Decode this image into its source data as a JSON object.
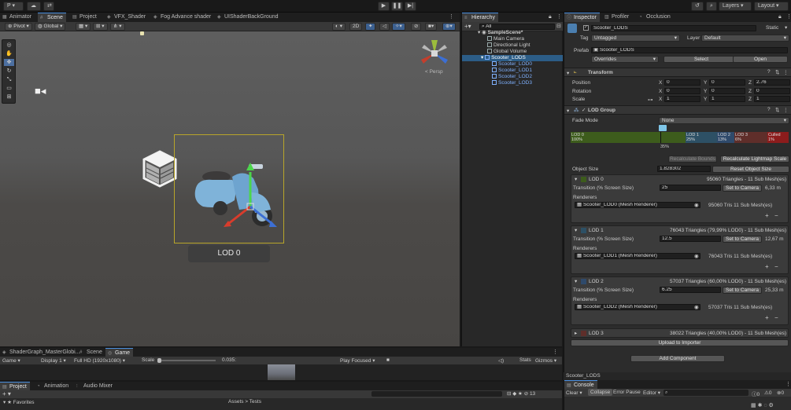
{
  "topbar": {
    "account": "P",
    "layers_label": "Layers",
    "layout_label": "Layout"
  },
  "scene_tabs": [
    {
      "label": "Animator",
      "icon": "animator-icon"
    },
    {
      "label": "Scene",
      "icon": "scene-icon"
    },
    {
      "label": "Project",
      "icon": "folder-icon"
    },
    {
      "label": "VFX_Shader",
      "icon": "shader-icon"
    },
    {
      "label": "Fog Advance shader",
      "icon": "shader-icon"
    },
    {
      "label": "UIShaderBackGround",
      "icon": "shader-icon"
    }
  ],
  "scene_toolbar": {
    "pivot": "Pivot",
    "global": "Global",
    "mode_2d": "2D",
    "persp": "< Persp"
  },
  "viewport": {
    "lod_label": "LOD 0"
  },
  "hierarchy": {
    "tab": "Hierarchy",
    "search_placeholder": "All",
    "items": [
      {
        "label": "SampleScene*",
        "indent": 0,
        "kind": "scene"
      },
      {
        "label": "Main Camera",
        "indent": 1,
        "kind": "obj"
      },
      {
        "label": "Directional Light",
        "indent": 1,
        "kind": "obj"
      },
      {
        "label": "Global Volume",
        "indent": 1,
        "kind": "obj"
      },
      {
        "label": "Scooter_LODS",
        "indent": 1,
        "kind": "selected"
      },
      {
        "label": "Scooter_LOD0",
        "indent": 2,
        "kind": "blue"
      },
      {
        "label": "Scooter_LOD1",
        "indent": 2,
        "kind": "blue"
      },
      {
        "label": "Scooter_LOD2",
        "indent": 2,
        "kind": "blue"
      },
      {
        "label": "Scooter_LOD3",
        "indent": 2,
        "kind": "blue"
      }
    ]
  },
  "game_tabs": [
    {
      "label": "ShaderGraph_MasterGlobi..."
    },
    {
      "label": "Scene"
    },
    {
      "label": "Game"
    }
  ],
  "game_toolbar": {
    "game": "Game",
    "display": "Display 1",
    "resolution": "Full HD (1920x1080)",
    "scale_label": "Scale",
    "scale_value": "0.035:",
    "play_focused": "Play Focused",
    "stats": "Stats",
    "gizmos": "Gizmos"
  },
  "project_tabs": [
    {
      "label": "Project"
    },
    {
      "label": "Animation"
    },
    {
      "label": "Audio Mixer"
    }
  ],
  "project_body": {
    "favorites": "Favorites",
    "breadcrumb": "Assets > Tests"
  },
  "inspector": {
    "tabs": [
      "Inspector",
      "Profiler",
      "Occlusion"
    ],
    "object_name": "Scooter_LODS",
    "static_label": "Static",
    "tag_label": "Tag",
    "tag_value": "Untagged",
    "layer_label": "Layer",
    "layer_value": "Default",
    "prefab_label": "Prefab",
    "prefab_value": "Scooter_LODS",
    "overrides": "Overrides",
    "select": "Select",
    "open": "Open",
    "transform": {
      "title": "Transform",
      "position_label": "Position",
      "rotation_label": "Rotation",
      "scale_label": "Scale",
      "position": [
        "0",
        "0",
        "2.76"
      ],
      "rotation": [
        "0",
        "0",
        "0"
      ],
      "scale": [
        "1",
        "1",
        "1"
      ],
      "axes": [
        "X",
        "Y",
        "Z"
      ]
    },
    "lod_group": {
      "title": "LOD Group",
      "fade_mode_label": "Fade Mode",
      "fade_mode_value": "None",
      "bar": [
        {
          "label": "LOD 0",
          "pct": "100%",
          "color": "#3d5c1c"
        },
        {
          "label": "LOD 1",
          "pct": "25%",
          "color": "#2d5065"
        },
        {
          "label": "LOD 2",
          "pct": "13%",
          "color": "#2f4a6b"
        },
        {
          "label": "LOD 3",
          "pct": "6%",
          "color": "#5f2e2a"
        },
        {
          "label": "Culled",
          "pct": "1%",
          "color": "#8c1c1c"
        }
      ],
      "marker_pct": "35%",
      "recalc_bounds": "Recalculate Bounds",
      "recalc_lightmap": "Recalculate Lightmap Scale",
      "object_size_label": "Object Size",
      "object_size_value": "1.828302",
      "reset_object_size": "Reset Object Size",
      "transition_label": "Transition (% Screen Size)",
      "renderers_label": "Renderers",
      "set_to_camera": "Set to Camera",
      "lods": [
        {
          "name": "LOD 0",
          "info": "95060 Triangles - 11 Sub Mesh(es)",
          "transition": "25",
          "distance": "6,33 m",
          "renderer": "Scooter_LOD0 (Mesh Renderer)",
          "tris": "95060 Tris 11 Sub Mesh(es)",
          "color": "#3d5c1c"
        },
        {
          "name": "LOD 1",
          "info": "76043 Triangles (79,99% LOD0) - 11 Sub Mesh(es)",
          "transition": "12.5",
          "distance": "12,67 m",
          "renderer": "Scooter_LOD1 (Mesh Renderer)",
          "tris": "76043 Tris 11 Sub Mesh(es)",
          "color": "#2d5065"
        },
        {
          "name": "LOD 2",
          "info": "57037 Triangles (60,00% LOD0) - 11 Sub Mesh(es)",
          "transition": "6.25",
          "distance": "25,33 m",
          "renderer": "Scooter_LOD2 (Mesh Renderer)",
          "tris": "57037 Tris 11 Sub Mesh(es)",
          "color": "#2f4a6b"
        }
      ],
      "lod3": {
        "name": "LOD 3",
        "info": "38022 Triangles (40,00% LOD0) - 11 Sub Mesh(es)",
        "color": "#5f2e2a"
      },
      "upload": "Upload to Importer"
    },
    "add_component": "Add Component"
  },
  "status": {
    "text": "Scooter_LODS"
  },
  "console": {
    "tab": "Console",
    "clear": "Clear",
    "collapse": "Collapse",
    "error_pause": "Error Pause",
    "editor": "Editor",
    "count_log": "0",
    "count_warn": "0",
    "count_err": "0"
  }
}
